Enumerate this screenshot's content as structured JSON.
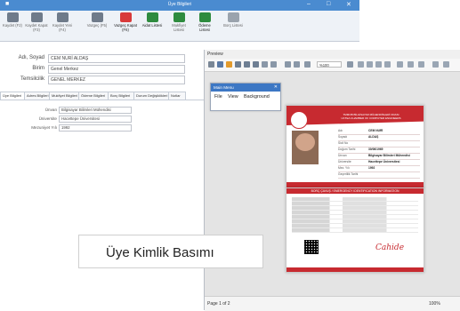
{
  "window": {
    "title": "Üye Bilgileri"
  },
  "toolbar": [
    {
      "label": "Kaydet (F2)",
      "icon": "save-icon",
      "color": "#6f7b8a"
    },
    {
      "label": "Kaydet Kapat (F3)",
      "icon": "save-icon",
      "color": "#6f7b8a"
    },
    {
      "label": "Kaydet Yeni (F4)",
      "icon": "save-icon",
      "color": "#6f7b8a"
    },
    {
      "label": "Vazgeç (F5)",
      "icon": "undo-icon",
      "color": "#6f7b8a"
    },
    {
      "label": "Vazgeç Kapat (F6)",
      "icon": "cancel-icon",
      "color": "#d83a3a"
    },
    {
      "label": "Aidat Listesi",
      "icon": "excel-icon",
      "color": "#2e8b3e"
    },
    {
      "label": "Mukfiyet Listesi",
      "icon": "excel-icon",
      "color": "#2e8b3e"
    },
    {
      "label": "Ödeme Listesi",
      "icon": "excel-icon",
      "color": "#2e8b3e"
    },
    {
      "label": "Borç Listesi",
      "icon": "excel-icon",
      "color": "#9aa3ad"
    }
  ],
  "form": {
    "fields": [
      {
        "label": "Adı, Soyad",
        "value": "CEM NURİ ALDAŞ"
      },
      {
        "label": "Birim",
        "value": "Genel Merkez"
      },
      {
        "label": "Temsilcilik",
        "value": "GENEL MERKEZ"
      }
    ]
  },
  "tabs": [
    "Üye Bilgileri",
    "Adres Bilgileri",
    "Mukfiyet Bilgileri",
    "Ödeme Bilgileri",
    "Borç Bilgileri",
    "Durum Değişiklikleri",
    "Notlar"
  ],
  "details": [
    {
      "label": "Ünvan",
      "value": "Bilgisayar Bilimleri Mühendisi"
    },
    {
      "label": "Üniversite",
      "value": "Hacettepe Üniversitesi"
    },
    {
      "label": "Mezuniyet Yılı",
      "value": "1992"
    }
  ],
  "preview": {
    "title": "Preview",
    "zoom": "%100",
    "page_status": "Page 1 of 2",
    "zoom_status": "100%"
  },
  "main_menu": {
    "title": "Main Menu",
    "items": [
      "File",
      "View",
      "Background"
    ]
  },
  "card_front": {
    "org_title": "TMMOB BİLGİSAYAR MÜHENDİSLERİ ODASI",
    "org_subtitle": "UCTEA CHAMBER OF COMPUTER ENGINEERS",
    "labels": [
      "Adı",
      "Soyadı",
      "Sicil No",
      "Doğum Tarihi",
      "Ünvan",
      "Üniversite",
      "Mez. Yılı",
      "Geçerlilik Tarihi"
    ],
    "values": [
      "CEM NURİ",
      "ALDAŞ",
      "",
      "30/06/1969",
      "Bilgisayar Bilimleri Mühendisi",
      "Hacettepe Üniversitesi",
      "1992",
      ""
    ]
  },
  "card_back": {
    "header": "BORÇ ÇAVUŞ / EMERGENCY IDENTIFICATION INFORMATION",
    "signature": "Cahide"
  },
  "caption": "Üye Kimlik Basımı"
}
